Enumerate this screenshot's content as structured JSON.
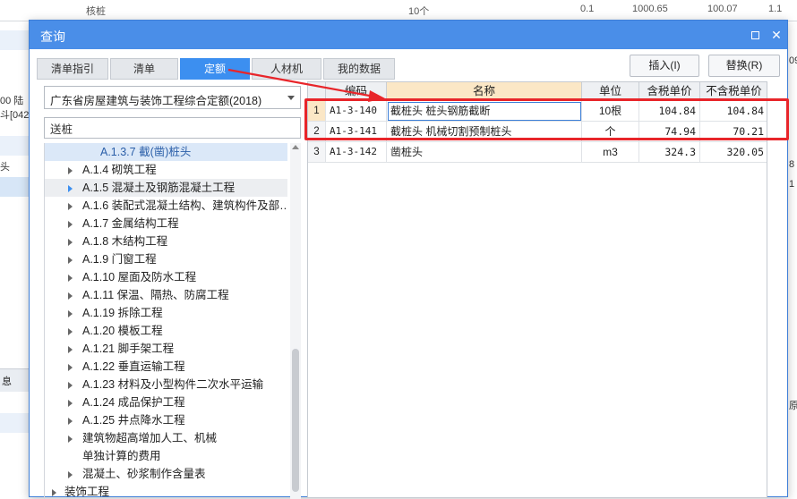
{
  "background": {
    "top_text_1": "核桩",
    "top_text_2": "10个",
    "top_text_3": "0.1",
    "top_text_4": "1000.65",
    "top_text_5": "100.07",
    "top_text_6": "1.1",
    "left_text_1": "00 陆",
    "left_text_2": "斗[042",
    "left_text_3": "头",
    "left_tab": "息",
    "right_text_1": "09",
    "right_text_2": "8",
    "right_text_3": "1",
    "right_text_4": "原"
  },
  "dialog": {
    "title": "查询",
    "tabs": [
      {
        "label": "清单指引",
        "active": false
      },
      {
        "label": "清单",
        "active": false
      },
      {
        "label": "定额",
        "active": true
      },
      {
        "label": "人材机",
        "active": false
      },
      {
        "label": "我的数据",
        "active": false
      }
    ],
    "insert_label": "插入(I)",
    "replace_label": "替换(R)",
    "library": "广东省房屋建筑与装饰工程综合定额(2018)",
    "search": {
      "value": "送桩",
      "placeholder": ""
    },
    "tree": [
      {
        "label": "A.1.3.7 截(凿)桩头",
        "arrow": false,
        "selected": true
      },
      {
        "label": "A.1.4 砌筑工程",
        "arrow": true
      },
      {
        "label": "A.1.5 混凝土及钢筋混凝土工程",
        "arrow": true,
        "hover": true
      },
      {
        "label": "A.1.6 装配式混凝土结构、建筑构件及部…",
        "arrow": true
      },
      {
        "label": "A.1.7 金属结构工程",
        "arrow": true
      },
      {
        "label": "A.1.8 木结构工程",
        "arrow": true
      },
      {
        "label": "A.1.9 门窗工程",
        "arrow": true
      },
      {
        "label": "A.1.10 屋面及防水工程",
        "arrow": true
      },
      {
        "label": "A.1.11 保温、隔热、防腐工程",
        "arrow": true
      },
      {
        "label": "A.1.19 拆除工程",
        "arrow": true
      },
      {
        "label": "A.1.20 模板工程",
        "arrow": true
      },
      {
        "label": "A.1.21 脚手架工程",
        "arrow": true
      },
      {
        "label": "A.1.22 垂直运输工程",
        "arrow": true
      },
      {
        "label": "A.1.23 材料及小型构件二次水平运输",
        "arrow": true
      },
      {
        "label": "A.1.24 成品保护工程",
        "arrow": true
      },
      {
        "label": "A.1.25 井点降水工程",
        "arrow": true
      },
      {
        "label": "建筑物超高增加人工、机械",
        "arrow": true
      },
      {
        "label": "单独计算的费用",
        "arrow": false
      },
      {
        "label": "混凝土、砂浆制作含量表",
        "arrow": true
      },
      {
        "label": "装饰工程",
        "arrow": true
      }
    ],
    "table": {
      "headers": [
        "",
        "编码",
        "名称",
        "单位",
        "含税单价",
        "不含税单价"
      ],
      "rows": [
        {
          "no": "1",
          "code": "A1-3-140",
          "name": "截桩头 桩头钢筋截断",
          "unit": "10根",
          "price_tax": "104.84",
          "price_notax": "104.84"
        },
        {
          "no": "2",
          "code": "A1-3-141",
          "name": "截桩头 机械切割预制桩头",
          "unit": "个",
          "price_tax": "74.94",
          "price_notax": "70.21"
        },
        {
          "no": "3",
          "code": "A1-3-142",
          "name": "凿桩头",
          "unit": "m3",
          "price_tax": "324.3",
          "price_notax": "320.05"
        }
      ]
    }
  },
  "colors": {
    "titlebar": "#4a8ee8",
    "active_tab": "#3c8ff0",
    "annotation": "#e8252a",
    "header_highlight": "#fbe7c6"
  }
}
